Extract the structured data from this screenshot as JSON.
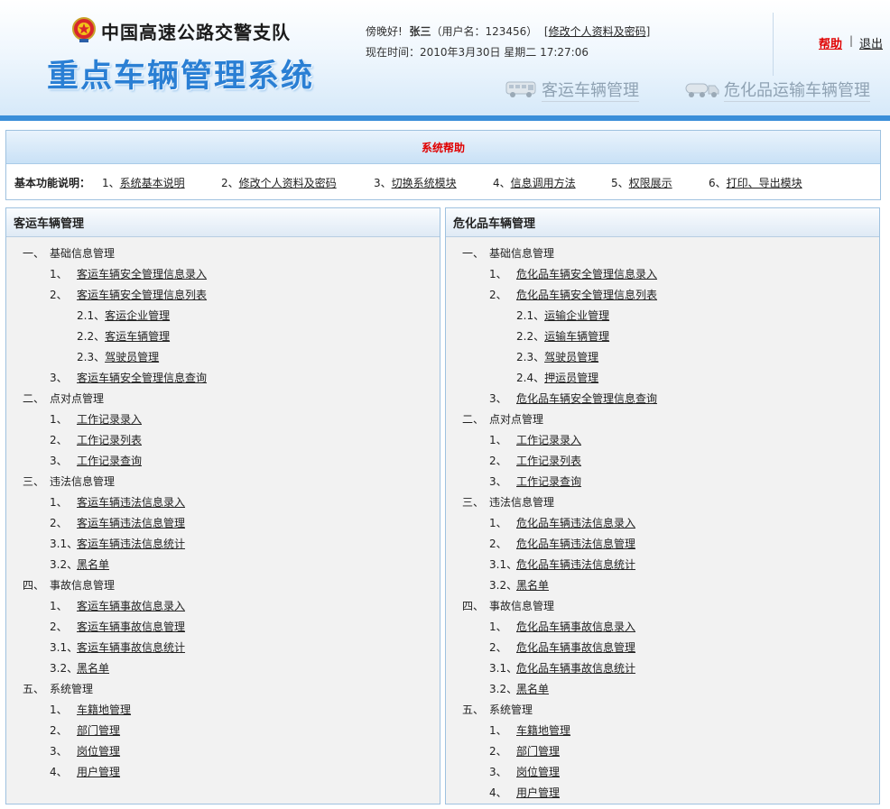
{
  "header": {
    "org_name": "中国高速公路交警支队",
    "system_title": "重点车辆管理系统",
    "greeting": "傍晚好!",
    "user_display": "张三",
    "username_note": "（用户名：123456）",
    "profile_link": "修改个人资料及密码",
    "clock_label": "现在时间：",
    "clock_value": "2010年3月30日 星期二 17:27:06",
    "help_label": "帮助",
    "separator": "|",
    "logout_label": "退出",
    "tab_bus": "客运车辆管理",
    "tab_hazmat": "危化品运输车辆管理"
  },
  "help_panel": {
    "title": "系统帮助",
    "lead": "基本功能说明：",
    "items": [
      {
        "num": "1、",
        "label": "系统基本说明"
      },
      {
        "num": "2、",
        "label": "修改个人资料及密码"
      },
      {
        "num": "3、",
        "label": "切换系统模块"
      },
      {
        "num": "4、",
        "label": "信息调用方法"
      },
      {
        "num": "5、",
        "label": "权限展示"
      },
      {
        "num": "6、",
        "label": "打印、导出模块"
      }
    ]
  },
  "bus_panel": {
    "title": "客运车辆管理",
    "rows": [
      {
        "level": 1,
        "num": "一、",
        "label": "基础信息管理"
      },
      {
        "level": 2,
        "num": "1、",
        "label": "客运车辆安全管理信息录入"
      },
      {
        "level": 2,
        "num": "2、",
        "label": "客运车辆安全管理信息列表"
      },
      {
        "level": 3,
        "num": "2.1、",
        "label": "客运企业管理"
      },
      {
        "level": 3,
        "num": "2.2、",
        "label": "客运车辆管理"
      },
      {
        "level": 3,
        "num": "2.3、",
        "label": "驾驶员管理"
      },
      {
        "level": 2,
        "num": "3、",
        "label": "客运车辆安全管理信息查询"
      },
      {
        "level": 1,
        "num": "二、",
        "label": "点对点管理"
      },
      {
        "level": 2,
        "num": "1、",
        "label": "工作记录录入"
      },
      {
        "level": 2,
        "num": "2、",
        "label": "工作记录列表"
      },
      {
        "level": 2,
        "num": "3、",
        "label": "工作记录查询"
      },
      {
        "level": 1,
        "num": "三、",
        "label": "违法信息管理"
      },
      {
        "level": 2,
        "num": "1、",
        "label": "客运车辆违法信息录入"
      },
      {
        "level": 2,
        "num": "2、",
        "label": "客运车辆违法信息管理"
      },
      {
        "level": 2,
        "num": "3.1、",
        "label": "客运车辆违法信息统计"
      },
      {
        "level": 2,
        "num": "3.2、",
        "label": "黑名单"
      },
      {
        "level": 1,
        "num": "四、",
        "label": "事故信息管理"
      },
      {
        "level": 2,
        "num": "1、",
        "label": "客运车辆事故信息录入"
      },
      {
        "level": 2,
        "num": "2、",
        "label": "客运车辆事故信息管理"
      },
      {
        "level": 2,
        "num": "3.1、",
        "label": "客运车辆事故信息统计"
      },
      {
        "level": 2,
        "num": "3.2、",
        "label": "黑名单"
      },
      {
        "level": 1,
        "num": "五、",
        "label": "系统管理"
      },
      {
        "level": 2,
        "num": "1、",
        "label": "车籍地管理"
      },
      {
        "level": 2,
        "num": "2、",
        "label": "部门管理"
      },
      {
        "level": 2,
        "num": "3、",
        "label": "岗位管理"
      },
      {
        "level": 2,
        "num": "4、",
        "label": "用户管理"
      }
    ]
  },
  "hazmat_panel": {
    "title": "危化品车辆管理",
    "rows": [
      {
        "level": 1,
        "num": "一、",
        "label": "基础信息管理"
      },
      {
        "level": 2,
        "num": "1、",
        "label": "危化品车辆安全管理信息录入"
      },
      {
        "level": 2,
        "num": "2、",
        "label": "危化品车辆安全管理信息列表"
      },
      {
        "level": 3,
        "num": "2.1、",
        "label": "运输企业管理"
      },
      {
        "level": 3,
        "num": "2.2、",
        "label": "运输车辆管理"
      },
      {
        "level": 3,
        "num": "2.3、",
        "label": "驾驶员管理"
      },
      {
        "level": 3,
        "num": "2.4、",
        "label": "押运员管理"
      },
      {
        "level": 2,
        "num": "3、",
        "label": "危化品车辆安全管理信息查询"
      },
      {
        "level": 1,
        "num": "二、",
        "label": "点对点管理"
      },
      {
        "level": 2,
        "num": "1、",
        "label": "工作记录录入"
      },
      {
        "level": 2,
        "num": "2、",
        "label": "工作记录列表"
      },
      {
        "level": 2,
        "num": "3、",
        "label": "工作记录查询"
      },
      {
        "level": 1,
        "num": "三、",
        "label": "违法信息管理"
      },
      {
        "level": 2,
        "num": "1、",
        "label": "危化品车辆违法信息录入"
      },
      {
        "level": 2,
        "num": "2、",
        "label": "危化品车辆违法信息管理"
      },
      {
        "level": 2,
        "num": "3.1、",
        "label": "危化品车辆违法信息统计"
      },
      {
        "level": 2,
        "num": "3.2、",
        "label": "黑名单"
      },
      {
        "level": 1,
        "num": "四、",
        "label": "事故信息管理"
      },
      {
        "level": 2,
        "num": "1、",
        "label": "危化品车辆事故信息录入"
      },
      {
        "level": 2,
        "num": "2、",
        "label": "危化品车辆事故信息管理"
      },
      {
        "level": 2,
        "num": "3.1、",
        "label": "危化品车辆事故信息统计"
      },
      {
        "level": 2,
        "num": "3.2、",
        "label": "黑名单"
      },
      {
        "level": 1,
        "num": "五、",
        "label": "系统管理"
      },
      {
        "level": 2,
        "num": "1、",
        "label": "车籍地管理"
      },
      {
        "level": 2,
        "num": "2、",
        "label": "部门管理"
      },
      {
        "level": 2,
        "num": "3、",
        "label": "岗位管理"
      },
      {
        "level": 2,
        "num": "4、",
        "label": "用户管理"
      }
    ]
  },
  "colors": {
    "accent_blue": "#3b8fd9",
    "title_blue": "#2a7fd4",
    "help_red": "#e00000"
  }
}
